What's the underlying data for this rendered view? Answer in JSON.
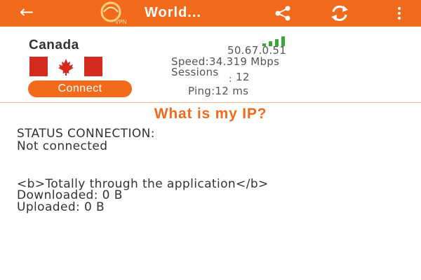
{
  "app_bar": {
    "title": "World...",
    "logo_text": "VPN",
    "color": "#f26a1b",
    "icons": [
      "back-arrow-icon",
      "app-logo",
      "share-icon",
      "refresh-icon",
      "more-vert-icon"
    ]
  },
  "server": {
    "country": "Canada",
    "flag": "canada-flag",
    "connect_label": "Connect",
    "ip": "50.67.0.51",
    "speed": "Speed:34.319 Mbps",
    "sessions_label": "Sessions",
    "sessions_colon": ":",
    "sessions_value": "12",
    "ping": "Ping:12 ms",
    "signal_bars": 4
  },
  "what_is_my_ip": "What is my IP?",
  "status": {
    "heading": "STATUS CONNECTION:",
    "value": "Not connected"
  },
  "traffic": {
    "through_app": "<b>Totally through the application</b>",
    "downloaded": "Downloaded: 0 B",
    "uploaded": "Uploaded: 0 B"
  },
  "colors": {
    "accent": "#f26a1b",
    "signal": "#3aa53a",
    "flag_red": "#d52b1e"
  }
}
